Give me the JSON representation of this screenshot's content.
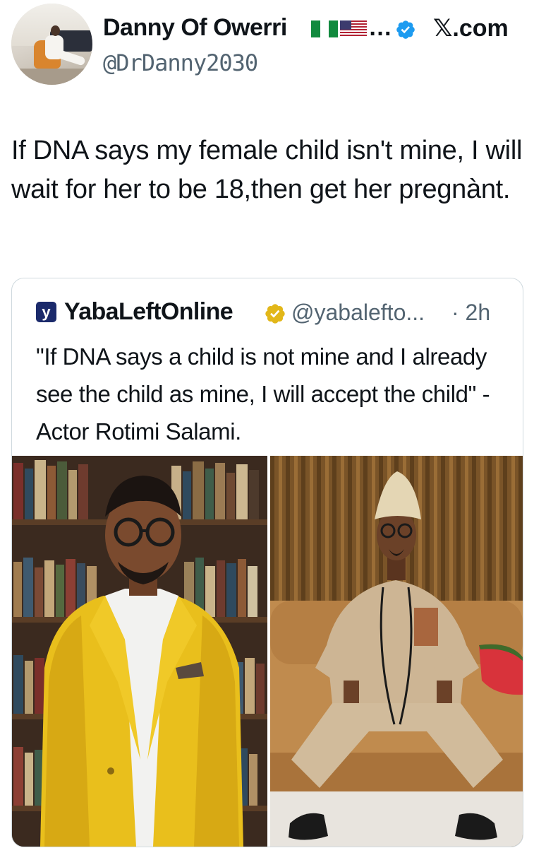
{
  "header": {
    "display_name": "Danny Of Owerri",
    "ellipsis": "…",
    "handle": "@DrDanny2030",
    "site_label": "𝕏.com",
    "verified_icon": "verified-badge-icon",
    "flags": [
      "nigeria-flag-icon",
      "usa-flag-icon"
    ]
  },
  "tweet": {
    "text": "If DNA says my female child isn't mine, I will wait for her to be 18,then get her pregnànt."
  },
  "quote": {
    "logo_letter": "y",
    "name": "YabaLeftOnline",
    "handle": "@yabalefto...",
    "time": "· 2h",
    "text": "\"If DNA says a child is not mine and I already see the child as mine, I will accept the child\" - Actor Rotimi Salami.",
    "verified_icon": "gold-verified-badge-icon"
  },
  "colors": {
    "text": "#0f1419",
    "secondary": "#536471",
    "border": "#cfd9de",
    "verified_blue": "#1d9bf0",
    "verified_gold": "#e2b719",
    "yellow_suit": "#e9bf1c"
  }
}
